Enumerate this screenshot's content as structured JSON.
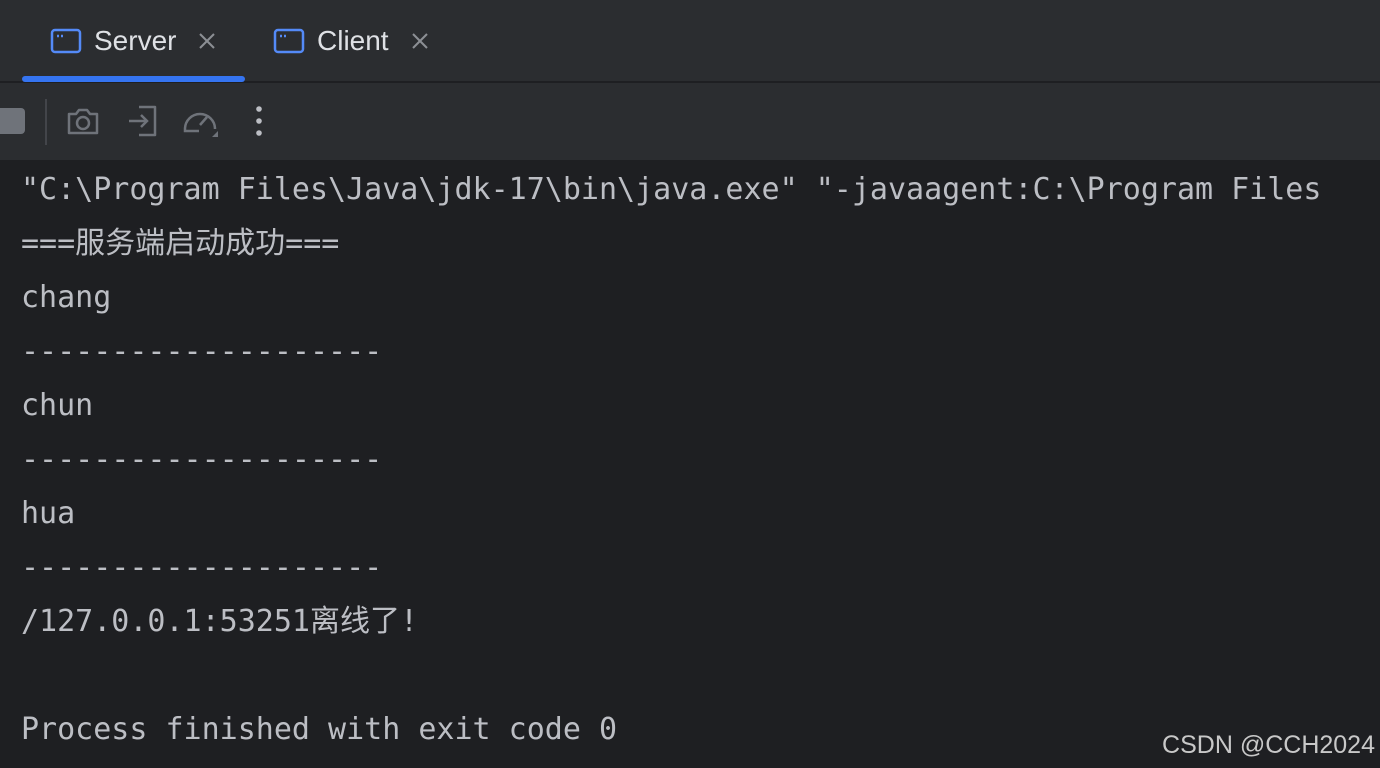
{
  "tabs": [
    {
      "label": "Server",
      "active": true,
      "icon": "console-window-icon"
    },
    {
      "label": "Client",
      "active": false,
      "icon": "console-window-icon"
    }
  ],
  "toolbar": {
    "buttons": [
      "stop-icon",
      "camera-icon",
      "login-icon",
      "speedometer-icon",
      "more-vertical-icon"
    ]
  },
  "console": {
    "lines": [
      "\"C:\\Program Files\\Java\\jdk-17\\bin\\java.exe\" \"-javaagent:C:\\Program Files",
      "===服务端启动成功===",
      "chang",
      "--------------------",
      "chun",
      "--------------------",
      "hua",
      "--------------------",
      "/127.0.0.1:53251离线了!",
      "",
      "Process finished with exit code 0"
    ]
  },
  "watermark": "CSDN @CCH2024",
  "colors": {
    "background": "#1e1f22",
    "panel": "#2b2d30",
    "accent": "#3574f0",
    "text": "#bcbec4"
  }
}
